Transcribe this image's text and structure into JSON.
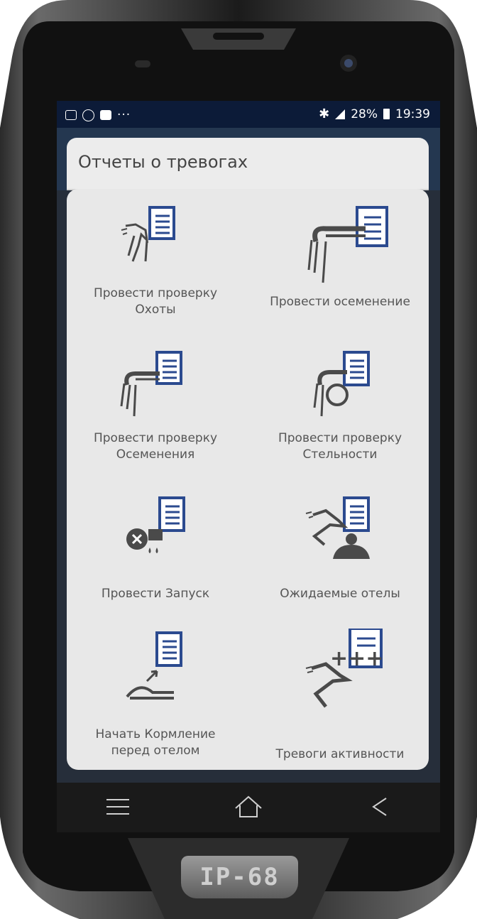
{
  "status_bar": {
    "battery_percent": "28%",
    "time": "19:39",
    "left_icons": [
      "image-icon",
      "eh-icon",
      "youtube-icon",
      "more-dots-icon"
    ],
    "dots": "···"
  },
  "header": {
    "title": "Отчеты о тревогах"
  },
  "menu": {
    "items": [
      {
        "label": "Провести проверку\nОхоты",
        "icon": "heat-check-icon"
      },
      {
        "label": "Провести осеменение",
        "icon": "insemination-icon"
      },
      {
        "label": "Провести проверку\nОсеменения",
        "icon": "insemination-check-icon"
      },
      {
        "label": "Провести проверку\nСтельности",
        "icon": "pregnancy-check-icon"
      },
      {
        "label": "Провести Запуск",
        "icon": "dry-off-icon"
      },
      {
        "label": "Ожидаемые отелы",
        "icon": "expected-calving-icon"
      },
      {
        "label": "Начать Кормление\nперед отелом",
        "icon": "pre-calving-feeding-icon"
      },
      {
        "label": "Тревоги активности",
        "icon": "activity-alerts-icon"
      }
    ]
  },
  "device": {
    "badge": "IP-68"
  },
  "colors": {
    "icon_dark": "#4a4a4a",
    "icon_blue": "#2b4a8f",
    "sheet_bg": "#e8e8e8",
    "screen_bg": "#0c1b38"
  }
}
